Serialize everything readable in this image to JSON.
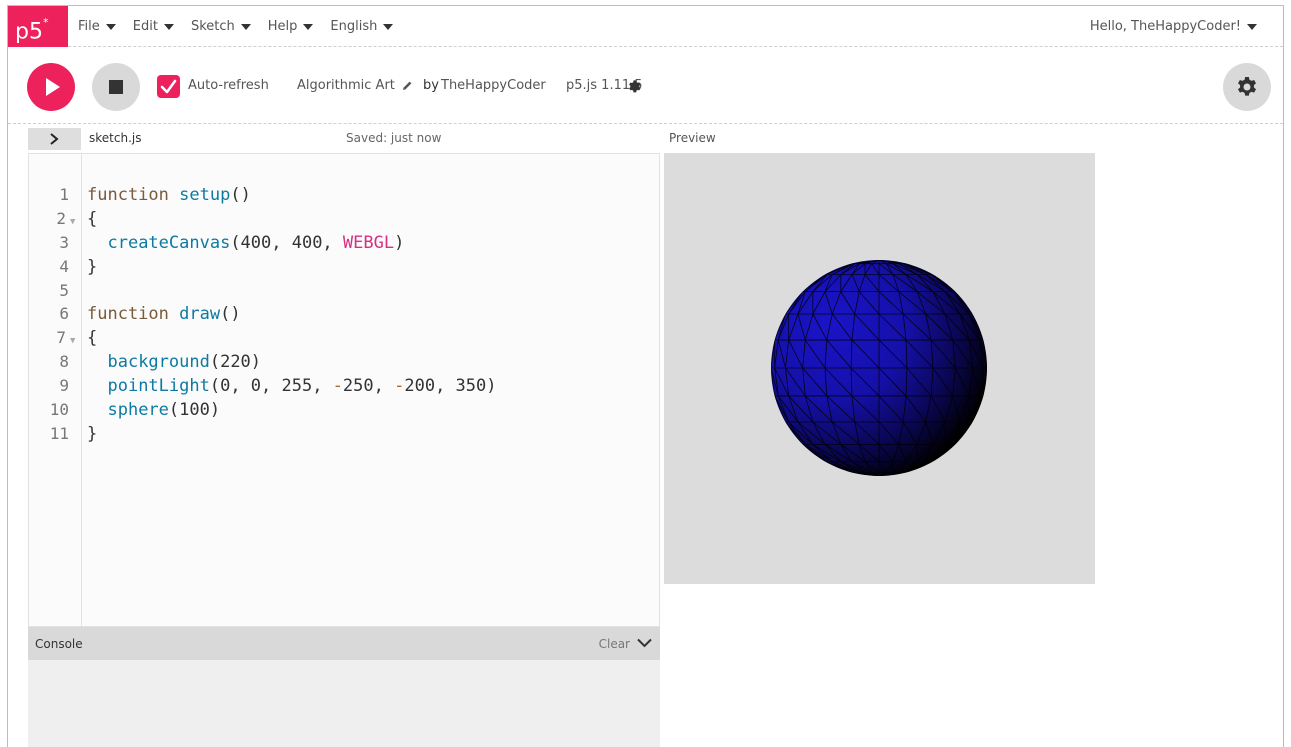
{
  "app": {
    "logo": "p5",
    "logo_mark": "*"
  },
  "menu": {
    "items": [
      {
        "label": "File"
      },
      {
        "label": "Edit"
      },
      {
        "label": "Sketch"
      },
      {
        "label": "Help"
      },
      {
        "label": "English"
      }
    ],
    "user": "Hello, TheHappyCoder!"
  },
  "toolbar": {
    "auto_refresh_label": "Auto-refresh",
    "auto_refresh_checked": true,
    "sketch_name": "Algorithmic Art",
    "by_label": "by",
    "author": "TheHappyCoder",
    "version": "p5.js 1.11.5"
  },
  "editor": {
    "file_name": "sketch.js",
    "saved_status": "Saved: just now",
    "line_numbers": [
      "1",
      "2",
      "3",
      "4",
      "5",
      "6",
      "7",
      "8",
      "9",
      "10",
      "11"
    ]
  },
  "console": {
    "title": "Console",
    "clear_label": "Clear"
  },
  "preview": {
    "label": "Preview"
  },
  "colors": {
    "accent": "#ed225d",
    "sphere": "#1a14b8",
    "canvas_bg": "#dcdcdc"
  }
}
